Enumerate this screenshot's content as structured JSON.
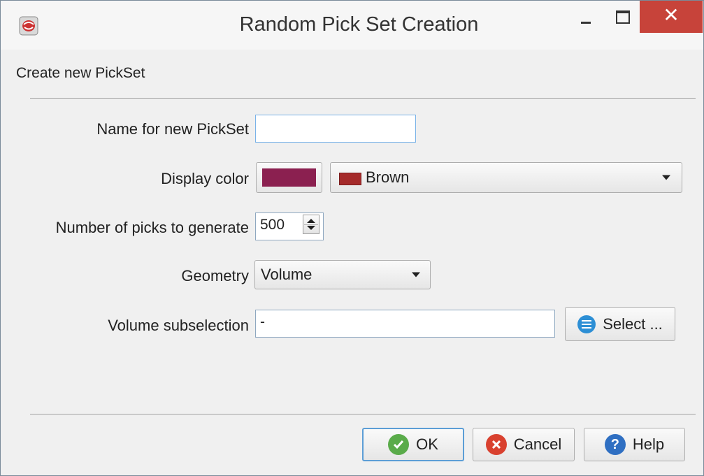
{
  "window": {
    "title": "Random Pick Set Creation",
    "close_glyph": "✕"
  },
  "form": {
    "heading": "Create new PickSet",
    "name_label": "Name for new PickSet",
    "name_value": "",
    "display_color_label": "Display color",
    "display_color_swatch": "#8b2050",
    "display_color_option": "Brown",
    "display_color_option_swatch": "#a52a2a",
    "picks_label": "Number of picks to generate",
    "picks_value": "500",
    "geometry_label": "Geometry",
    "geometry_value": "Volume",
    "subsel_label": "Volume subselection",
    "subsel_value": "-",
    "select_button": "Select ..."
  },
  "buttons": {
    "ok": "OK",
    "cancel": "Cancel",
    "help": "Help"
  },
  "icons": {
    "app": "app-icon",
    "select": "list-icon",
    "ok": "check-icon",
    "cancel": "x-icon",
    "help": "question-icon"
  },
  "colors": {
    "close_button": "#c7433a",
    "ok_icon": "#5aab4a",
    "cancel_icon": "#d9412f",
    "help_icon": "#2f6fc2",
    "select_icon": "#2d8fd5"
  }
}
